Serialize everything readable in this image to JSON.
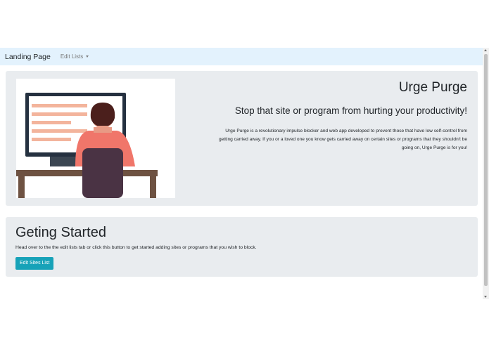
{
  "navbar": {
    "brand": "Landing Page",
    "edit_lists": "Edit Lists"
  },
  "hero": {
    "title": "Urge Purge",
    "subtitle": "Stop that site or program from hurting your productivity!",
    "description": "Urge Purge is a revolutionary impulse blocker and web app developed to prevent those that have low self-control from getting carried away. If you or a loved one you know gets carried away on certain sites or programs that they shouldn't be going on, Urge Purge is for you!"
  },
  "getting_started": {
    "title": "Geting Started",
    "text": "Head over to the the edit lists tab or click this button to get started adding sites or programs that you wish to block.",
    "button_label": "Edit Sites List"
  },
  "colors": {
    "navbar_bg": "#e3f2fd",
    "jumbotron_bg": "#e9ecef",
    "button_bg": "#17a2b8"
  }
}
